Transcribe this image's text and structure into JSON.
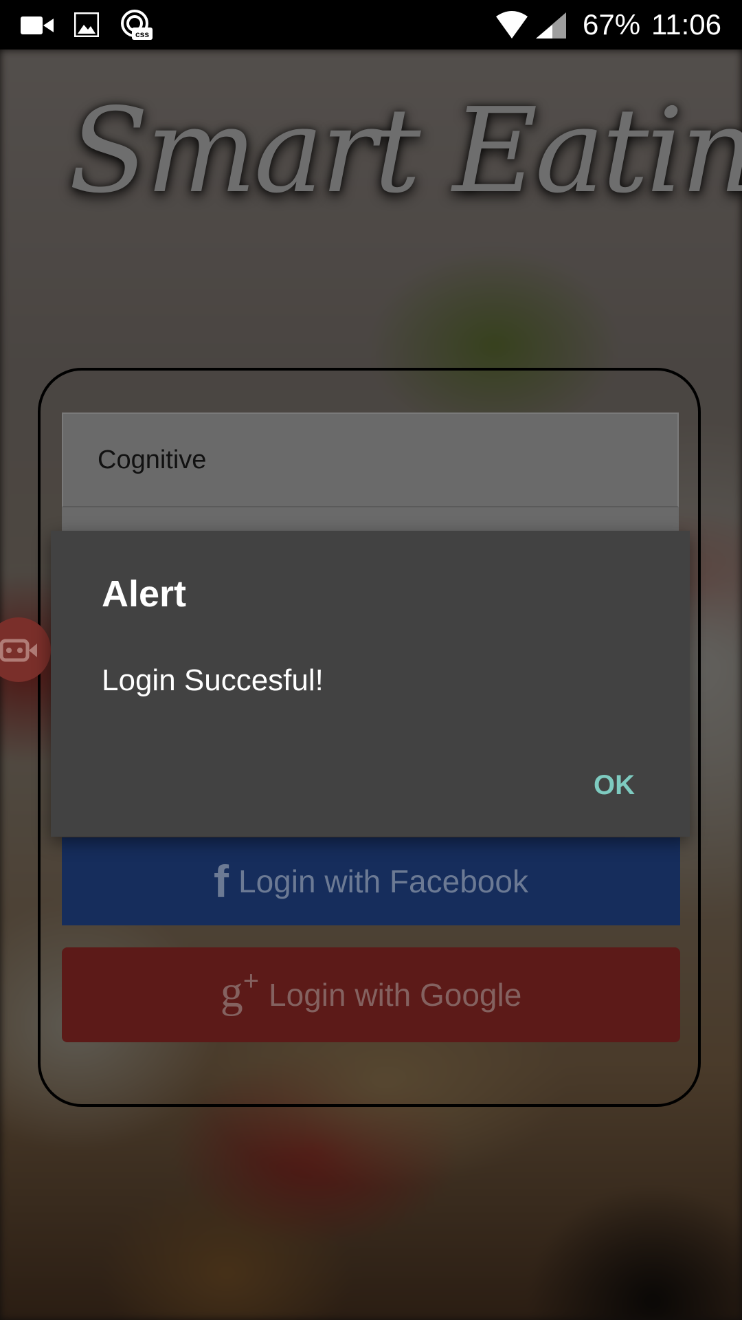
{
  "status_bar": {
    "battery_text": "67%",
    "time": "11:06",
    "icons": [
      "video-camera-icon",
      "image-icon",
      "css-app-icon",
      "wifi-icon",
      "cell-signal-icon"
    ]
  },
  "app": {
    "title": "Smart Eating"
  },
  "login_form": {
    "username_value": "Cognitive",
    "facebook_label": "Login with Facebook",
    "facebook_icon": "f",
    "google_label": "Login with Google",
    "google_icon": "g",
    "google_icon_plus": "+"
  },
  "alert": {
    "title": "Alert",
    "message": "Login Succesful!",
    "ok_label": "OK"
  },
  "colors": {
    "status_bar": "#000000",
    "dialog_bg": "#424242",
    "ok_accent": "#7ecbc0",
    "facebook": "#162d5c",
    "google": "#5c1a18"
  }
}
